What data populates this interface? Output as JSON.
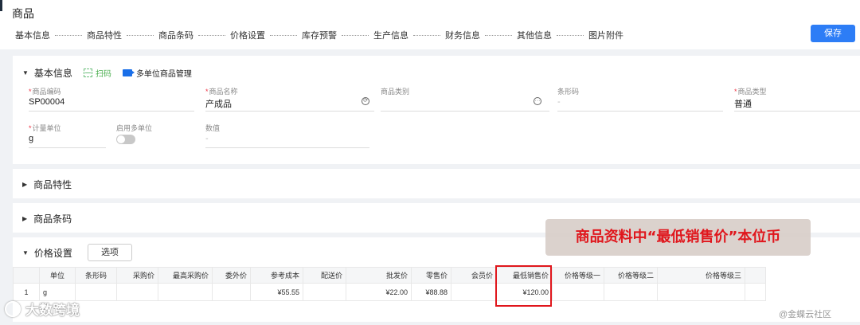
{
  "page": {
    "title": "商品"
  },
  "steps": [
    "基本信息",
    "商品特性",
    "商品条码",
    "价格设置",
    "库存预警",
    "生产信息",
    "财务信息",
    "其他信息",
    "图片附件"
  ],
  "toolbar": {
    "save_label": "保存"
  },
  "basic": {
    "title": "基本信息",
    "scan_label": "扫码",
    "multi_unit_label": "多单位商品管理",
    "fields": {
      "code": {
        "label": "商品编码",
        "value": "SP00004"
      },
      "name": {
        "label": "商品名称",
        "value": "产成品"
      },
      "category": {
        "label": "商品类别",
        "value": ""
      },
      "barcode": {
        "label": "条形码",
        "value": "-"
      },
      "type": {
        "label": "商品类型",
        "value": "普通"
      },
      "unit": {
        "label": "计量单位",
        "value": "g"
      },
      "multi_unit": {
        "label": "启用多单位",
        "enabled": false
      },
      "quantity": {
        "label": "数值",
        "value": "-"
      }
    }
  },
  "features": {
    "title": "商品特性"
  },
  "barcodes": {
    "title": "商品条码"
  },
  "pricing": {
    "title": "价格设置",
    "options_label": "选项",
    "columns": [
      "单位",
      "条形码",
      "采购价",
      "最高采购价",
      "委外价",
      "参考成本",
      "配送价",
      "批发价",
      "零售价",
      "会员价",
      "最低销售价",
      "价格等级一",
      "价格等级二",
      "价格等级三"
    ],
    "row": {
      "index": "1",
      "cells": [
        "g",
        "",
        "",
        "",
        "",
        "¥55.55",
        "",
        "¥22.00",
        "¥88.88",
        "",
        "¥120.00",
        "",
        "",
        ""
      ]
    }
  },
  "annotation": {
    "text": "商品资料中“最低销售价”本位币"
  },
  "watermarks": {
    "left": "大数跨境",
    "right": "@金蝶云社区"
  },
  "colors": {
    "primary": "#2d7df6",
    "annotation_red": "#e0161c",
    "scan_green": "#6bbf7b"
  }
}
